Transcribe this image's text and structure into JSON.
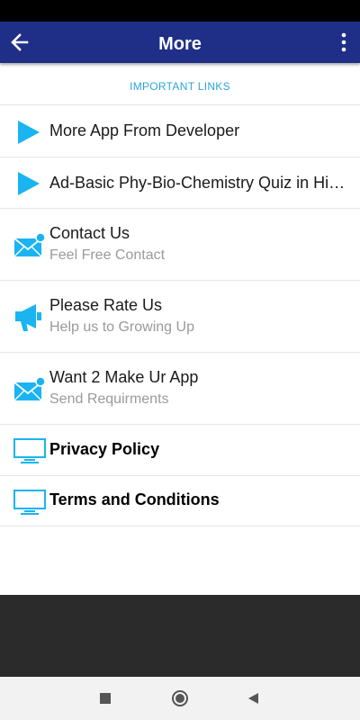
{
  "appbar": {
    "title": "More"
  },
  "section": {
    "header": "IMPORTANT LINKS"
  },
  "items": [
    {
      "title": "More App From Developer"
    },
    {
      "title": "Ad-Basic Phy-Bio-Chemistry Quiz in Hindi"
    },
    {
      "title": "Contact Us",
      "subtitle": "Feel Free Contact"
    },
    {
      "title": "Please Rate Us",
      "subtitle": "Help us to Growing Up"
    },
    {
      "title": "Want 2 Make Ur App",
      "subtitle": "Send Requirments"
    },
    {
      "title": "Privacy Policy"
    },
    {
      "title": "Terms and Conditions"
    }
  ],
  "colors": {
    "appbar": "#1f2f87",
    "accent": "#2aa7e0",
    "icon": "#1ab4f0",
    "footer": "#2b2b2b"
  }
}
